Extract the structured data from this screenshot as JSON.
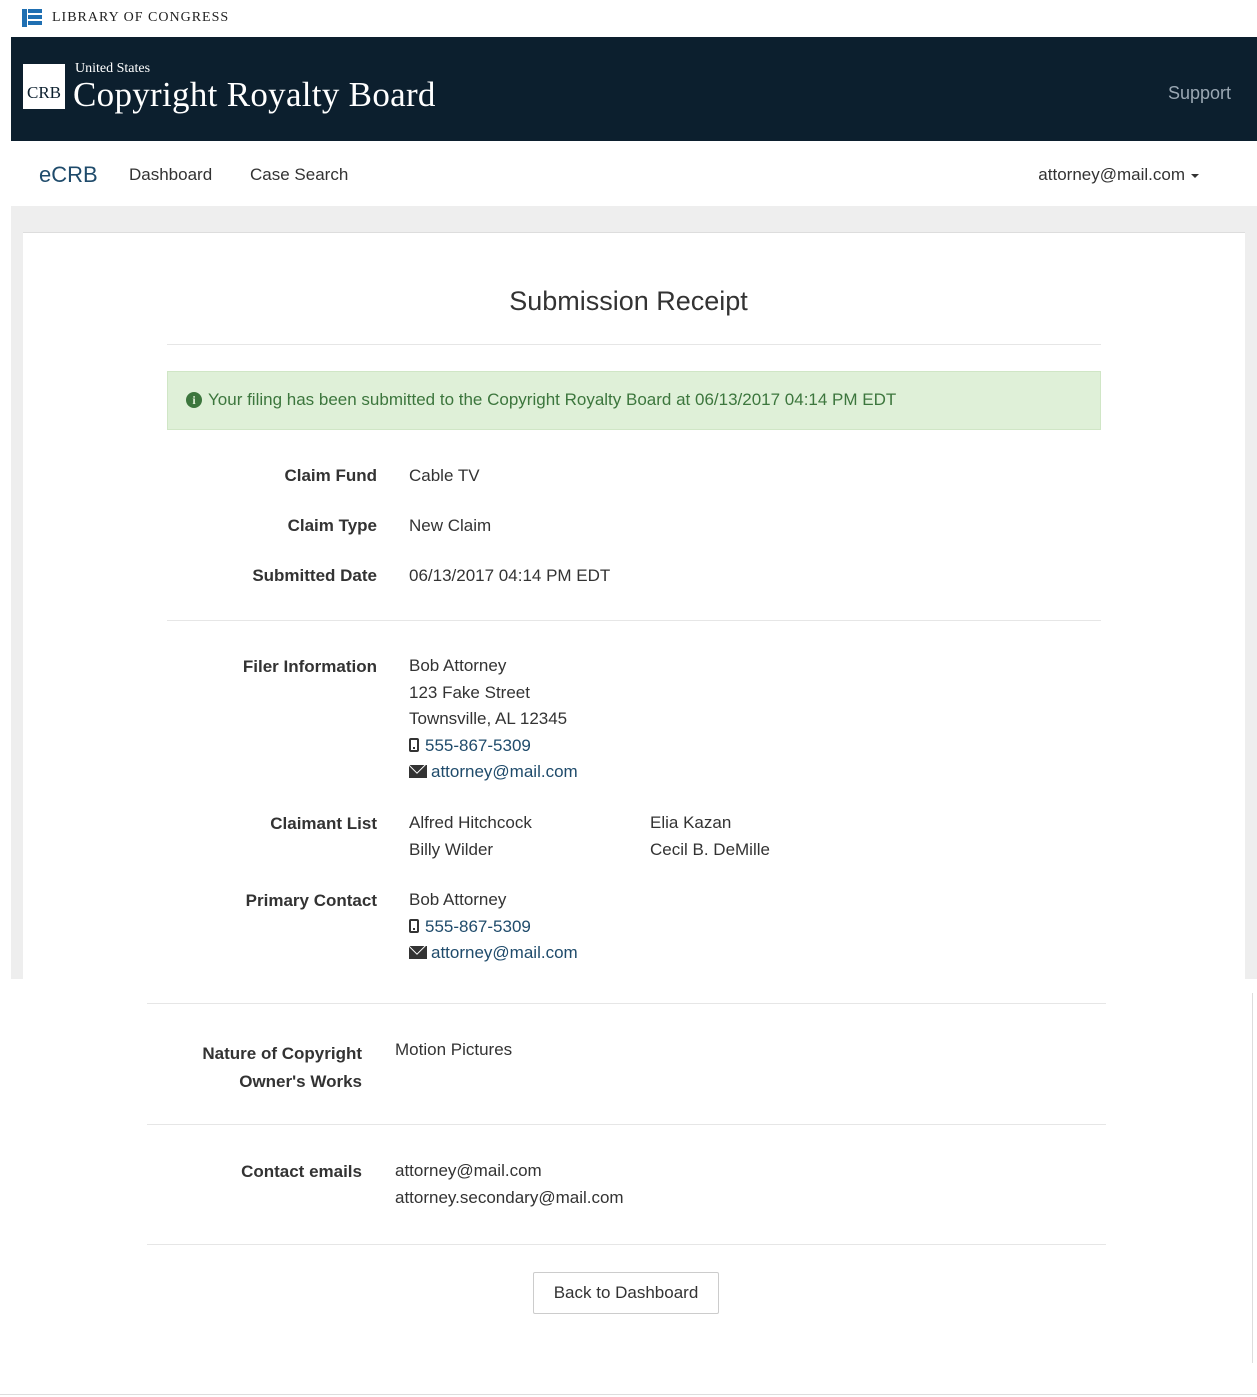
{
  "loc_bar": {
    "text": "LIBRARY OF CONGRESS"
  },
  "header": {
    "logo_abbrev": "CRB",
    "subtitle": "United States",
    "title": "Copyright Royalty Board",
    "support_label": "Support"
  },
  "nav": {
    "brand": "eCRB",
    "links": [
      "Dashboard",
      "Case Search"
    ],
    "user": "attorney@mail.com"
  },
  "page": {
    "title": "Submission Receipt",
    "alert": "Your filing has been submitted to the Copyright Royalty Board at 06/13/2017 04:14 PM EDT",
    "alert_icon": "info-circle-icon"
  },
  "summary": [
    {
      "label": "Claim Fund",
      "value": "Cable TV"
    },
    {
      "label": "Claim Type",
      "value": "New Claim"
    },
    {
      "label": "Submitted Date",
      "value": "06/13/2017 04:14 PM EDT"
    }
  ],
  "filer": {
    "label": "Filer Information",
    "name": "Bob Attorney",
    "street": "123 Fake Street",
    "city": "Townsville, AL 12345",
    "phone": "555-867-5309",
    "email": "attorney@mail.com"
  },
  "claimants": {
    "label": "Claimant List",
    "col1": [
      "Alfred Hitchcock",
      "Billy Wilder"
    ],
    "col2": [
      "Elia Kazan",
      "Cecil B. DeMille"
    ]
  },
  "primary_contact": {
    "label": "Primary Contact",
    "name": "Bob Attorney",
    "phone": "555-867-5309",
    "email": "attorney@mail.com"
  },
  "nature": {
    "label_line1": "Nature of Copyright",
    "label_line2": "Owner's Works",
    "value": "Motion Pictures"
  },
  "contact_emails": {
    "label": "Contact emails",
    "values": [
      "attorney@mail.com",
      "attorney.secondary@mail.com"
    ]
  },
  "footer": {
    "back_label": "Back to Dashboard"
  }
}
